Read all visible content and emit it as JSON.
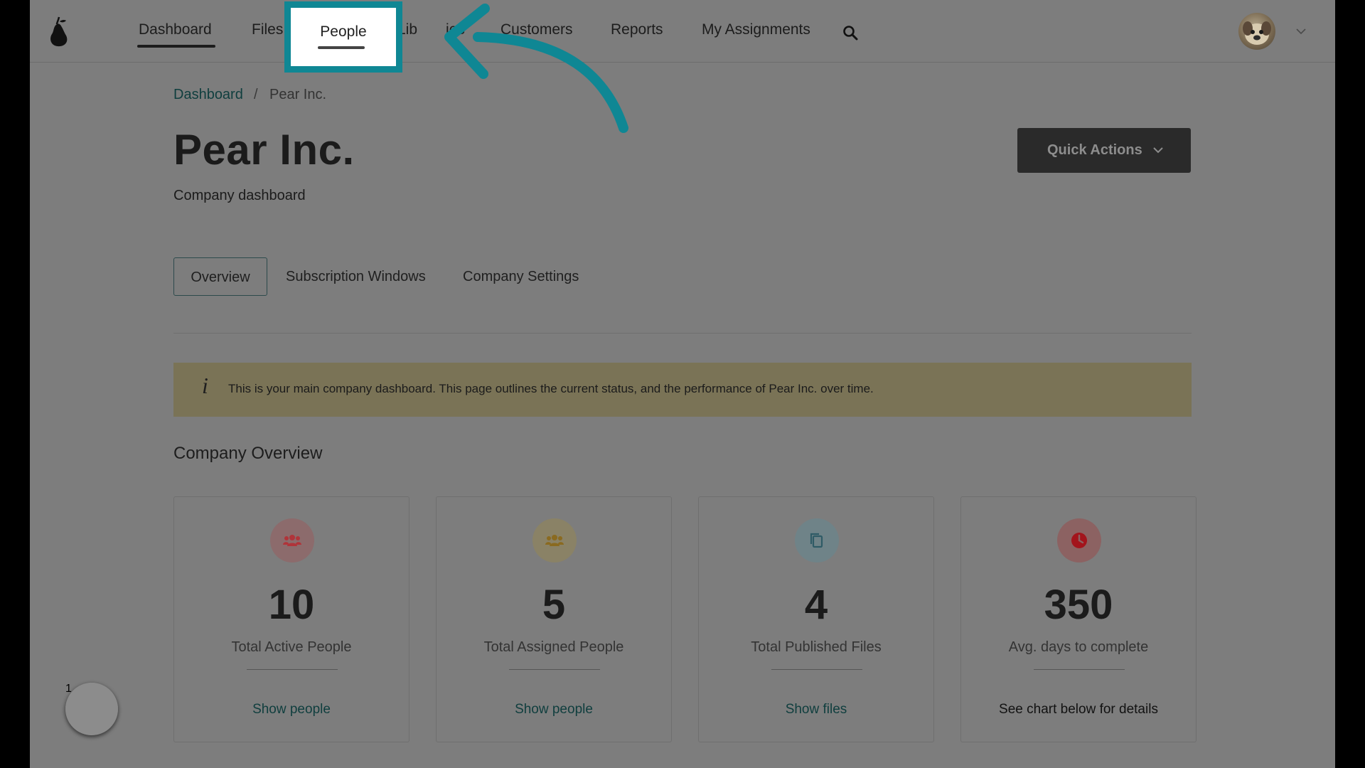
{
  "nav": {
    "items": [
      {
        "label": "Dashboard"
      },
      {
        "label": "Files"
      },
      {
        "label": "People"
      },
      {
        "label": "Libraries"
      },
      {
        "label": "Customers"
      },
      {
        "label": "Reports"
      },
      {
        "label": "My Assignments"
      }
    ],
    "highlighted_label": "People",
    "partial_libraries": [
      "Lib",
      "ies"
    ]
  },
  "breadcrumb": {
    "home": "Dashboard",
    "separator": "/",
    "current": "Pear Inc."
  },
  "page": {
    "title": "Pear Inc.",
    "subtitle": "Company dashboard"
  },
  "quick_actions": {
    "label": "Quick Actions"
  },
  "tabs": [
    {
      "label": "Overview",
      "active": true
    },
    {
      "label": "Subscription Windows",
      "active": false
    },
    {
      "label": "Company Settings",
      "active": false
    }
  ],
  "banner": {
    "icon": "info-icon",
    "text": "This is your main company dashboard. This page outlines the current status, and the performance of Pear Inc. over time."
  },
  "overview": {
    "title": "Company Overview",
    "cards": [
      {
        "value": "10",
        "caption": "Total Active People",
        "action": "Show people",
        "icon": "people-icon",
        "icon_color": "#b0343a",
        "bg_color": "#8c6b6c"
      },
      {
        "value": "5",
        "caption": "Total Assigned People",
        "action": "Show people",
        "icon": "people-icon",
        "icon_color": "#8a6a20",
        "bg_color": "#8a8266"
      },
      {
        "value": "4",
        "caption": "Total Published Files",
        "action": "Show files",
        "icon": "copy-icon",
        "icon_color": "#2f5b66",
        "bg_color": "#6f8388"
      },
      {
        "value": "350",
        "caption": "Avg. days to complete",
        "action": "See chart below for details",
        "icon": "clock-icon",
        "icon_color": "#a3141c",
        "bg_color": "#8c6262"
      }
    ]
  },
  "help": {
    "badge": "1"
  },
  "colors": {
    "accent": "#0f8794",
    "overlay": "#7d7d7d"
  }
}
